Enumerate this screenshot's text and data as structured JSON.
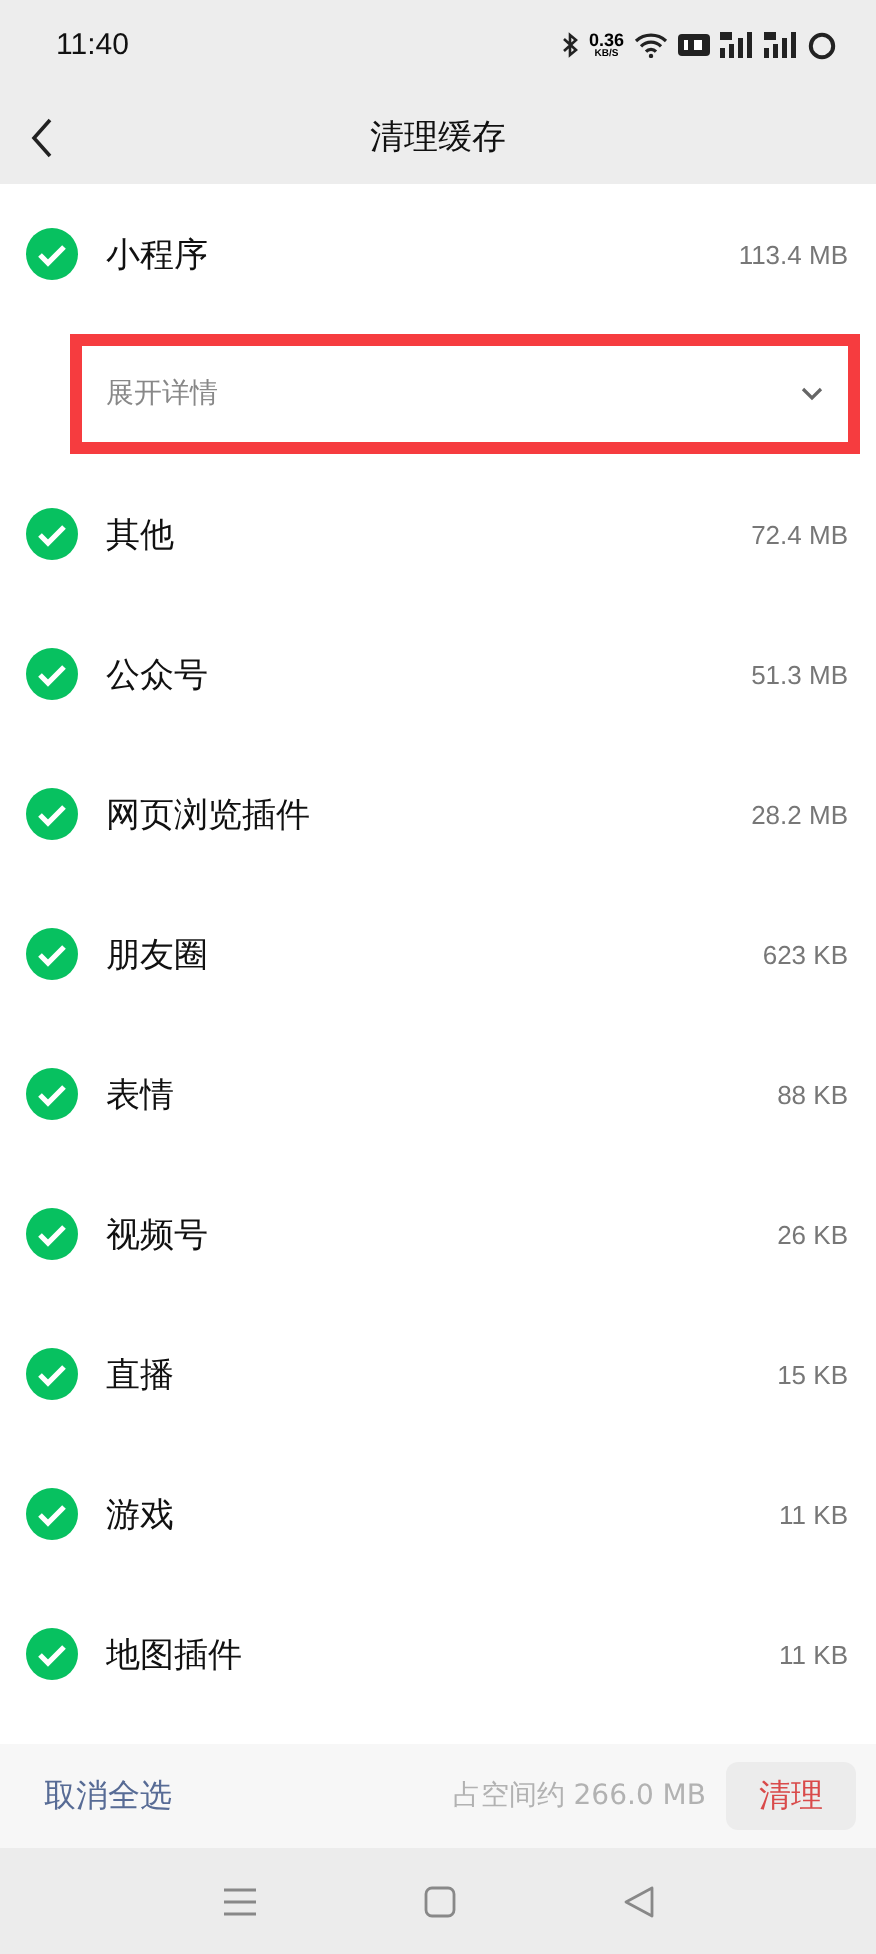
{
  "status_bar": {
    "time": "11:40",
    "net_speed": "0.36",
    "net_unit": "KB/S"
  },
  "header": {
    "title": "清理缓存"
  },
  "items": [
    {
      "kind": "item",
      "name": "小程序",
      "size": "113.4 MB",
      "checked": true
    },
    {
      "kind": "expand",
      "label": "展开详情",
      "highlighted": true
    },
    {
      "kind": "item",
      "name": "其他",
      "size": "72.4 MB",
      "checked": true
    },
    {
      "kind": "item",
      "name": "公众号",
      "size": "51.3 MB",
      "checked": true
    },
    {
      "kind": "item",
      "name": "网页浏览插件",
      "size": "28.2 MB",
      "checked": true
    },
    {
      "kind": "item",
      "name": "朋友圈",
      "size": "623 KB",
      "checked": true
    },
    {
      "kind": "item",
      "name": "表情",
      "size": "88 KB",
      "checked": true
    },
    {
      "kind": "item",
      "name": "视频号",
      "size": "26 KB",
      "checked": true
    },
    {
      "kind": "item",
      "name": "直播",
      "size": "15 KB",
      "checked": true
    },
    {
      "kind": "item",
      "name": "游戏",
      "size": "11 KB",
      "checked": true
    },
    {
      "kind": "item",
      "name": "地图插件",
      "size": "11 KB",
      "checked": true
    }
  ],
  "footer": {
    "deselect": "取消全选",
    "total": "占空间约 266.0 MB",
    "clean": "清理"
  }
}
